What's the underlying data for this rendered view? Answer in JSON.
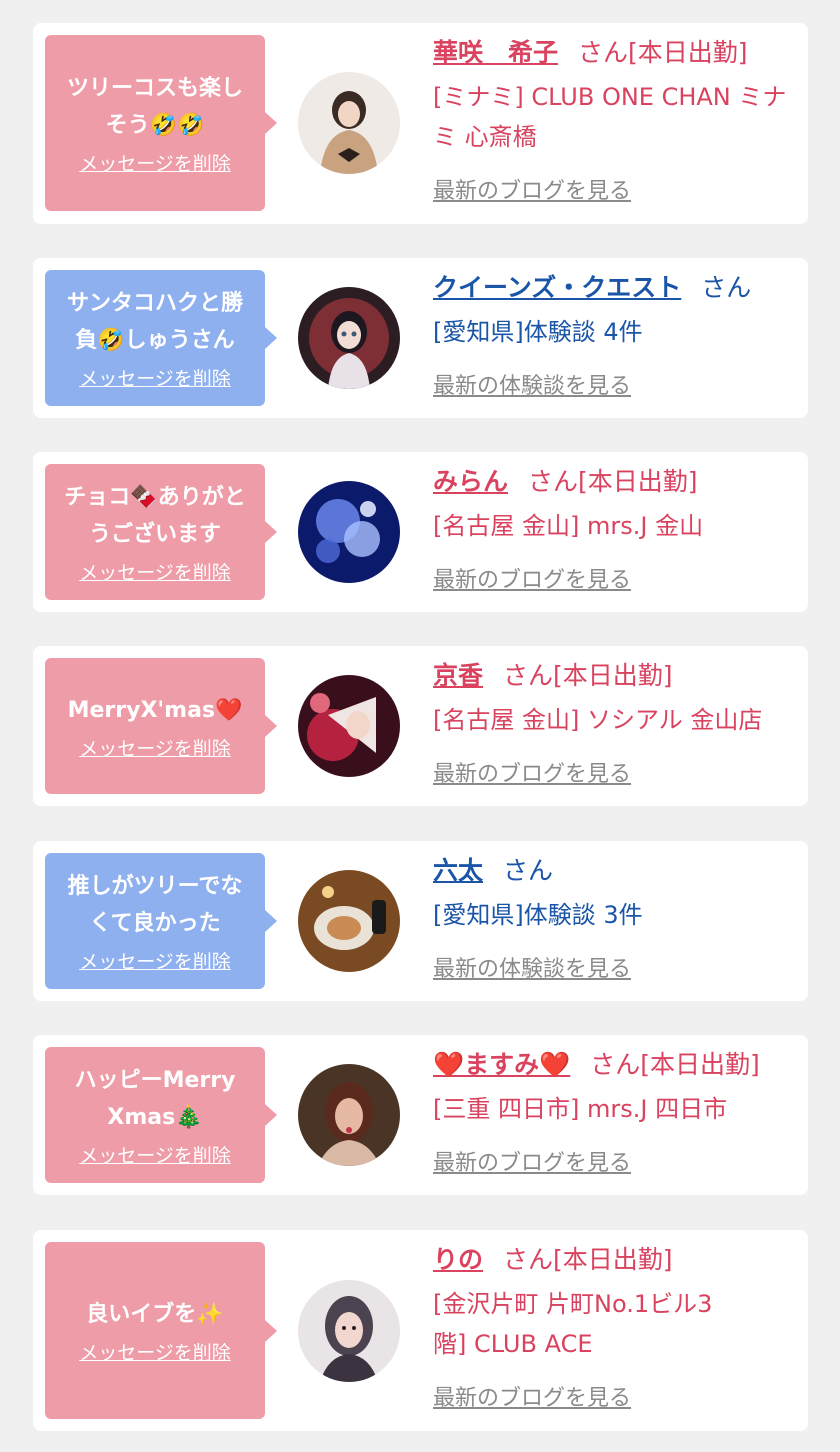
{
  "delete_label": "メッセージを削除",
  "colors": {
    "pink_bubble": "#ee9ca7",
    "blue_bubble": "#8fb0ef",
    "girl_text": "#d9435f",
    "user_text": "#1a55a8",
    "link_gray": "#8a8a8a"
  },
  "cards": [
    {
      "type": "girl",
      "message_lines": [
        "ツリーコスも楽し",
        "そう🤣🤣"
      ],
      "name": "華咲　希子",
      "suffix": "さん[本日出勤]",
      "shop_lines": [
        "[ミナミ] CLUB ONE CHAN ミナ",
        "ミ 心斎橋"
      ],
      "more": "最新のブログを見る"
    },
    {
      "type": "user",
      "message_lines": [
        "サンタコハクと勝",
        "負🤣しゅうさん"
      ],
      "name": "クイーンズ・クエスト",
      "suffix": "さん",
      "shop_lines": [
        "[愛知県]体験談 4件"
      ],
      "more": "最新の体験談を見る"
    },
    {
      "type": "girl",
      "message_lines": [
        "チョコ🍫ありがと",
        "うございます"
      ],
      "name": "みらん",
      "suffix": "さん[本日出勤]",
      "shop_lines": [
        "[名古屋 金山] mrs.J 金山"
      ],
      "more": "最新のブログを見る"
    },
    {
      "type": "girl",
      "message_lines": [
        "MerryX'mas❤️"
      ],
      "name": "京香",
      "suffix": "さん[本日出勤]",
      "shop_lines": [
        "[名古屋 金山] ソシアル 金山店"
      ],
      "more": "最新のブログを見る"
    },
    {
      "type": "user",
      "message_lines": [
        "推しがツリーでな",
        "くて良かった"
      ],
      "name": "六太",
      "suffix": "さん",
      "shop_lines": [
        "[愛知県]体験談 3件"
      ],
      "more": "最新の体験談を見る"
    },
    {
      "type": "girl",
      "message_lines": [
        "ハッピーMerry",
        "Xmas🎄"
      ],
      "name": "❤️ますみ❤️",
      "suffix": "さん[本日出勤]",
      "shop_lines": [
        "[三重 四日市] mrs.J 四日市"
      ],
      "more": "最新のブログを見る"
    },
    {
      "type": "girl",
      "message_lines": [
        "良いイブを✨"
      ],
      "name": "りの",
      "suffix": "さん[本日出勤]",
      "shop_lines": [
        "[金沢片町 片町No.1ビル3",
        "階] CLUB ACE"
      ],
      "more": "最新のブログを見る"
    }
  ]
}
